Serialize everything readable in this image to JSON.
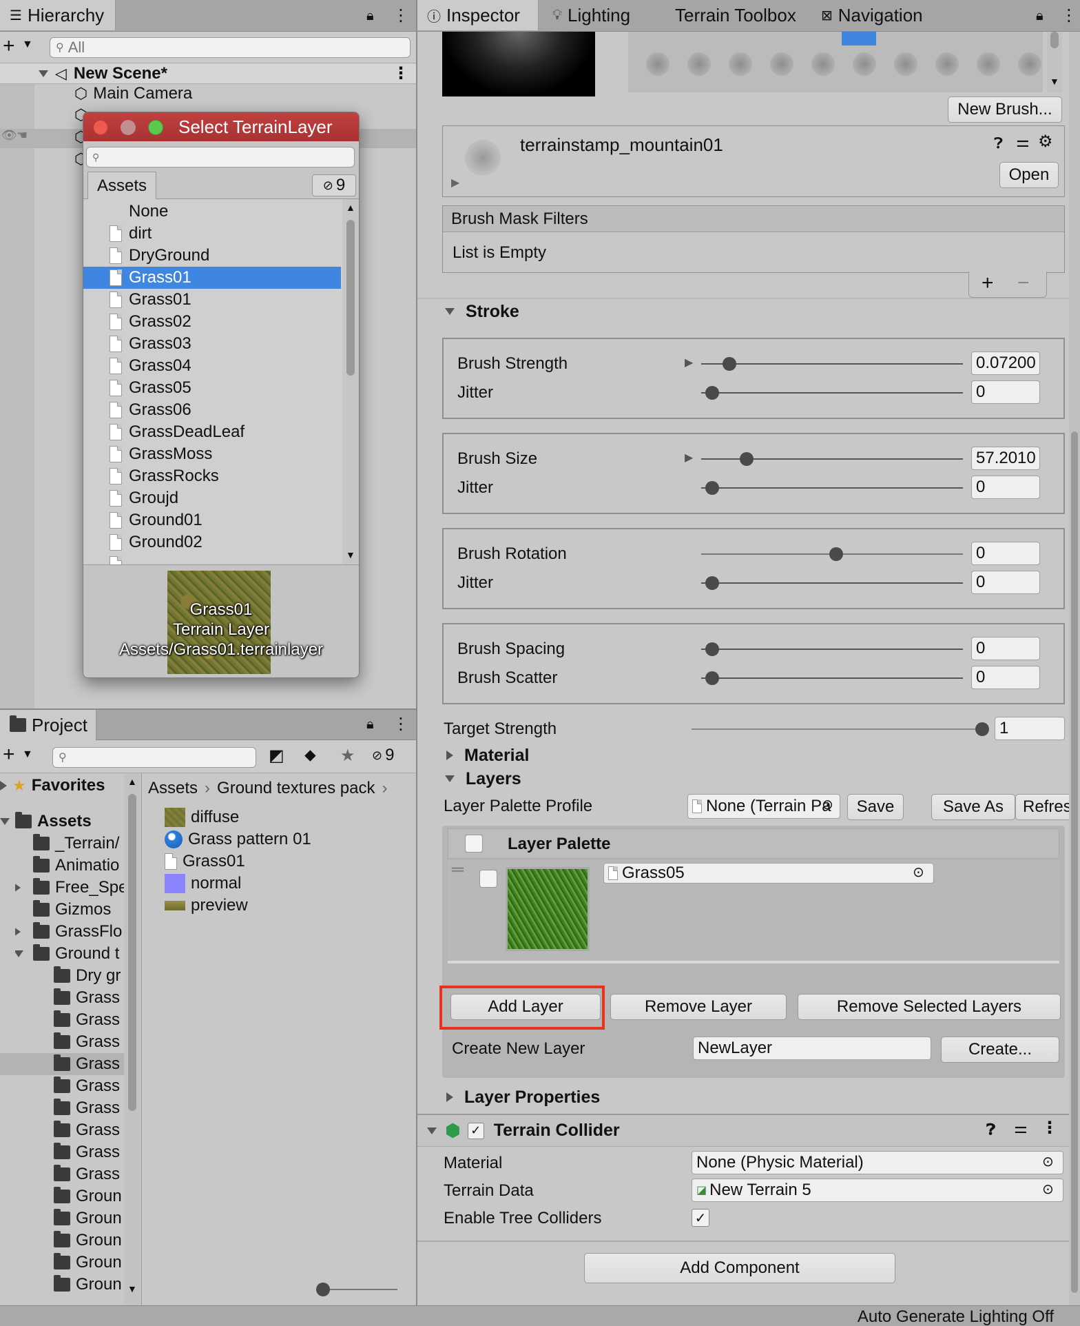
{
  "hierarchy": {
    "tab": "Hierarchy",
    "search_placeholder": "All",
    "scene": "New Scene*",
    "items": [
      "Main Camera"
    ]
  },
  "picker": {
    "title": "Select TerrainLayer",
    "tab": "Assets",
    "hidden_count": "9",
    "items": [
      "None",
      "dirt",
      "DryGround",
      "Grass01",
      "Grass01",
      "Grass02",
      "Grass03",
      "Grass04",
      "Grass05",
      "Grass06",
      "GrassDeadLeaf",
      "GrassMoss",
      "GrassRocks",
      "Groujd",
      "Ground01",
      "Ground02"
    ],
    "selected_index": 3,
    "preview": {
      "name": "Grass01",
      "type": "Terrain Layer",
      "path": "Assets/Grass01.terrainlayer"
    }
  },
  "project": {
    "tab": "Project",
    "hidden_count": "9",
    "favorites": "Favorites",
    "assets_root": "Assets",
    "folders": [
      "_Terrain/",
      "Animatio",
      "Free_Spe",
      "Gizmos",
      "GrassFlo",
      "Ground t"
    ],
    "subfolders": [
      "Dry gr",
      "Grass",
      "Grass",
      "Grass",
      "Grass",
      "Grass",
      "Grass",
      "Grass",
      "Grass",
      "Grass",
      "Groun",
      "Groun",
      "Groun",
      "Groun",
      "Groun"
    ],
    "breadcrumb": [
      "Assets",
      "Ground textures pack"
    ],
    "files": [
      "diffuse",
      "Grass pattern 01",
      "Grass01",
      "normal",
      "preview"
    ]
  },
  "inspector": {
    "tabs": [
      "Inspector",
      "Lighting",
      "Terrain Toolbox",
      "Navigation"
    ],
    "new_brush": "New Brush...",
    "brush_name": "terrainstamp_mountain01",
    "open": "Open",
    "mask_filters": "Brush Mask Filters",
    "list_empty": "List is Empty",
    "stroke": "Stroke",
    "sliders": [
      {
        "label": "Brush Strength",
        "value": "0.07200",
        "pos": 0.07
      },
      {
        "label": "Jitter",
        "value": "0",
        "pos": 0
      },
      {
        "label": "Brush Size",
        "value": "57.2010",
        "pos": 0.14
      },
      {
        "label": "Jitter",
        "value": "0",
        "pos": 0
      },
      {
        "label": "Brush Rotation",
        "value": "0",
        "pos": 0.5
      },
      {
        "label": "Jitter",
        "value": "0",
        "pos": 0
      },
      {
        "label": "Brush Spacing",
        "value": "0",
        "pos": 0
      },
      {
        "label": "Brush Scatter",
        "value": "0",
        "pos": 0
      }
    ],
    "target_strength": {
      "label": "Target Strength",
      "value": "1",
      "pos": 1
    },
    "material": "Material",
    "layers": "Layers",
    "palette_profile": "Layer Palette Profile",
    "palette_value": "None (Terrain Pa",
    "save": "Save",
    "save_as": "Save As",
    "refresh": "Refres",
    "layer_palette": "Layer Palette",
    "layer_name": "Grass05",
    "add_layer": "Add Layer",
    "remove_layer": "Remove Layer",
    "remove_selected": "Remove Selected Layers",
    "create_new_layer": "Create New Layer",
    "new_layer_value": "NewLayer",
    "create": "Create...",
    "layer_properties": "Layer Properties",
    "collider": {
      "title": "Terrain Collider",
      "material_label": "Material",
      "material_value": "None (Physic Material)",
      "terrain_data_label": "Terrain Data",
      "terrain_data_value": "New Terrain 5",
      "tree_colliders_label": "Enable Tree Colliders"
    },
    "add_component": "Add Component"
  },
  "status": "Auto Generate Lighting Off",
  "colors": {
    "selection": "#3f86e0",
    "highlight": "#e8321e",
    "picker_title": "#b83838"
  }
}
